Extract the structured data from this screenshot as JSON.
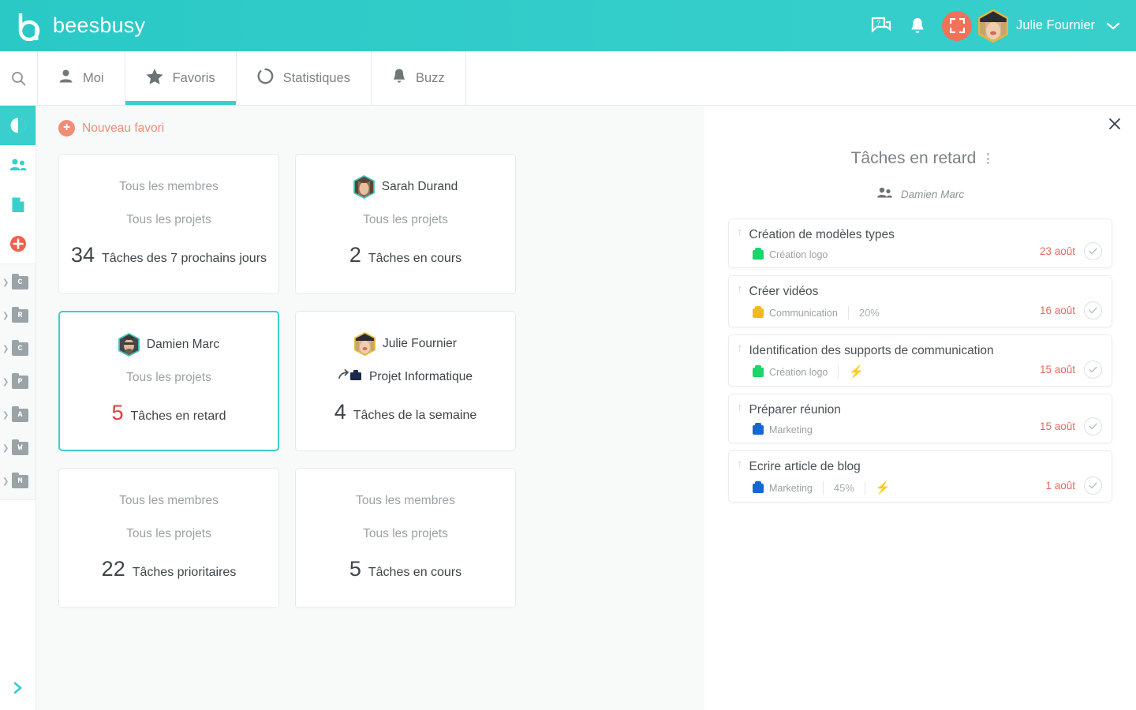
{
  "brand": {
    "name": "beesbusy",
    "teal": "#2ac9c6",
    "coral": "#ef7259",
    "red": "#e0393e"
  },
  "header": {
    "help_icon": "chat-help-icon",
    "bell_icon": "bell-icon",
    "fullscreen_icon": "fullscreen-icon",
    "avatar": "julie-avatar",
    "user_name": "Julie Fournier",
    "chevron": "chevron-down-icon"
  },
  "tabs": {
    "search_icon": "search-icon",
    "items": [
      {
        "label": "Moi",
        "icon": "person-icon",
        "active": false
      },
      {
        "label": "Favoris",
        "icon": "star-icon",
        "active": true
      },
      {
        "label": "Statistiques",
        "icon": "pie-chart-icon",
        "active": false
      },
      {
        "label": "Buzz",
        "icon": "bell-icon",
        "active": false
      }
    ]
  },
  "rail": {
    "top_items": [
      {
        "name": "dashboard-icon",
        "selected": true
      },
      {
        "name": "team-icon",
        "selected": false
      },
      {
        "name": "document-icon",
        "selected": false
      },
      {
        "name": "add-icon",
        "selected": false
      }
    ],
    "projects": [
      {
        "letter": "C"
      },
      {
        "letter": "R"
      },
      {
        "letter": "C"
      },
      {
        "letter": "P"
      },
      {
        "letter": "A"
      },
      {
        "letter": "W"
      },
      {
        "letter": "M"
      }
    ],
    "expand_icon": "chevron-right-icon"
  },
  "main": {
    "new_favorite": "Nouveau favori",
    "cards": [
      {
        "line1": "Tous les membres",
        "line1_avatar": null,
        "line2": "Tous les projets",
        "line2_icon": null,
        "count": "34",
        "count_label": "Tâches des 7 prochains jours",
        "selected": false,
        "count_red": false
      },
      {
        "line1": "Sarah Durand",
        "line1_avatar": "sarah-avatar",
        "line2": "Tous les projets",
        "line2_icon": null,
        "count": "2",
        "count_label": "Tâches en cours",
        "selected": false,
        "count_red": false
      },
      {
        "line1": "Damien Marc",
        "line1_avatar": "damien-avatar",
        "line2": "Tous les projets",
        "line2_icon": null,
        "count": "5",
        "count_label": "Tâches en retard",
        "selected": true,
        "count_red": true
      },
      {
        "line1": "Julie Fournier",
        "line1_avatar": "julie-avatar",
        "line2": "Projet Informatique",
        "line2_icon": "share-briefcase-icon",
        "count": "4",
        "count_label": "Tâches de la semaine",
        "selected": false,
        "count_red": false
      },
      {
        "line1": "Tous les membres",
        "line1_avatar": null,
        "line2": "Tous les projets",
        "line2_icon": null,
        "count": "22",
        "count_label": "Tâches prioritaires",
        "selected": false,
        "count_red": false
      },
      {
        "line1": "Tous les membres",
        "line1_avatar": null,
        "line2": "Tous les projets",
        "line2_icon": null,
        "count": "5",
        "count_label": "Tâches en cours",
        "selected": false,
        "count_red": false
      }
    ]
  },
  "panel": {
    "close_icon": "close-icon",
    "title": "Tâches en retard",
    "menu_icon": "more-vertical-icon",
    "subject_icon": "team-icon",
    "subject": "Damien Marc",
    "tasks": [
      {
        "title": "Création de modèles types",
        "project": "Création logo",
        "project_color": "#17d66a",
        "percent": null,
        "priority": true,
        "date": "23 août"
      },
      {
        "title": "Créer vidéos",
        "project": "Communication",
        "project_color": "#f4b824",
        "percent": "20%",
        "priority": false,
        "date": "16 août"
      },
      {
        "title": "Identification des supports de communication",
        "project": "Création logo",
        "project_color": "#17d66a",
        "percent": null,
        "priority": true,
        "date": "15 août"
      },
      {
        "title": "Préparer réunion",
        "project": "Marketing",
        "project_color": "#1667d6",
        "percent": null,
        "priority": false,
        "date": "15 août"
      },
      {
        "title": "Ecrire article de blog",
        "project": "Marketing",
        "project_color": "#1667d6",
        "percent": "45%",
        "priority": true,
        "date": "1 août"
      }
    ]
  }
}
